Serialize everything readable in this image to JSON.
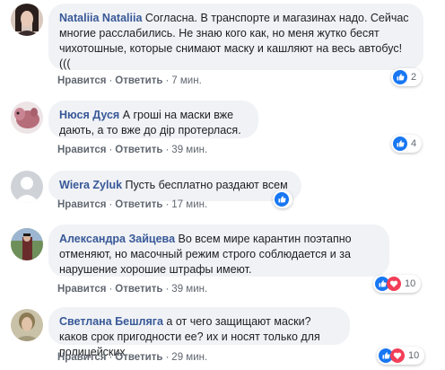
{
  "comments": [
    {
      "author": "Nataliia Nataliia",
      "text": "Согласна. В транспорте и магазинах надо. Сейчас многие расслабились. Не знаю кого как, но меня жутко бесят чихотошные, которые снимают маску и кашляют на весь автобус!(((",
      "like": "Нравится",
      "reply": "Ответить",
      "time": "7 мин.",
      "reaction_count": "2",
      "reactions": [
        "like"
      ]
    },
    {
      "author": "Нюся Дуся",
      "text": "А гроші на маски вже дають, а то вже до дір протерлася.",
      "like": "Нравится",
      "reply": "Ответить",
      "time": "39 мин.",
      "reaction_count": "4",
      "reactions": [
        "like"
      ]
    },
    {
      "author": "Wiera Zyluk",
      "text": "Пусть бесплатно раздают всем",
      "like": "Нравится",
      "reply": "Ответить",
      "time": "17 мин.",
      "reaction_count": "",
      "reactions": [
        "like"
      ]
    },
    {
      "author": "Александра Зайцева",
      "text": "Во всем мире карантин поэтапно отменяют, но масочный режим строго соблюдается и за нарушение хорошие штрафы имеют.",
      "like": "Нравится",
      "reply": "Ответить",
      "time": "39 мин.",
      "reaction_count": "10",
      "reactions": [
        "like",
        "love"
      ]
    },
    {
      "author": "Светлана Бешляга",
      "text": "а от чего защищают маски? каков срок пригодности ее? их и носят только для полицейских",
      "like": "Нравится",
      "reply": "Ответить",
      "time": "29 мин.",
      "reaction_count": "10",
      "reactions": [
        "like",
        "love"
      ]
    }
  ],
  "colors": {
    "author": "#385898",
    "bubble": "#f0f2f5",
    "meta": "#606770",
    "like": "#1877f2",
    "love": "#f33e58"
  },
  "icons": {
    "like": "thumbs-up-icon",
    "love": "heart-icon"
  }
}
